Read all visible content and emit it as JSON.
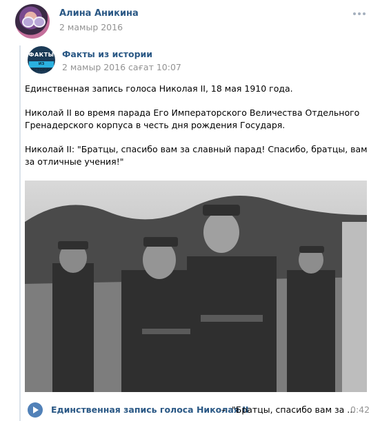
{
  "post": {
    "author": "Алина Аникина",
    "date": "2 мамыр 2016"
  },
  "repost": {
    "group_name": "Факты из истории",
    "group_logo_top": "ФАКТЫ",
    "group_logo_bottom": "ИЗ ИСТОРИИ",
    "date": "2 мамыр 2016 сағат 10:07",
    "paragraphs": [
      "Единственная запись голоса Николая II, 18 мая 1910 года.",
      "Николай II во время парада Его Императорского Величества Отдельного Гренадерского корпуса в честь дня рождения Государя.",
      "Николай II: \"Братцы, спасибо вам за славный парад! Спасибо, братцы, вам за отличные учения!\""
    ],
    "audio": {
      "artist": "Единственная запись голоса Николая II",
      "separator": "–",
      "title": "\"Братцы, спасибо вам за ...",
      "duration": "0:42",
      "accent_color": "#5181b8"
    }
  },
  "icons": {
    "more": "more-dots-icon",
    "play": "play-icon"
  }
}
